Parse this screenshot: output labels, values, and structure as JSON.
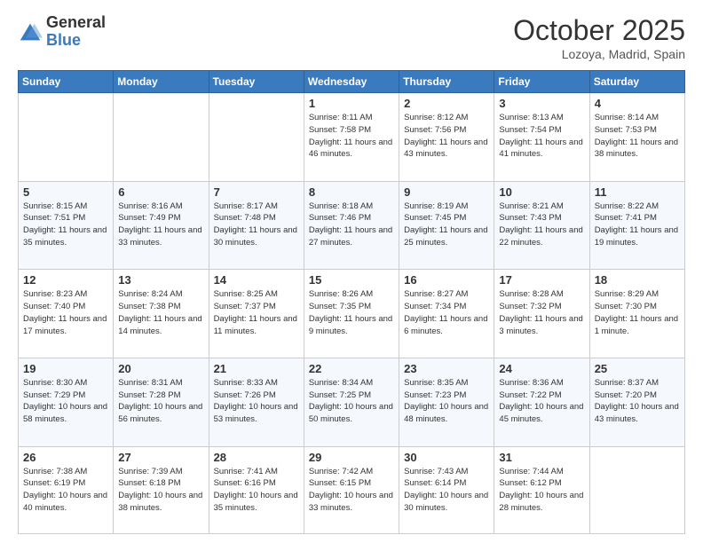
{
  "header": {
    "logo": {
      "general": "General",
      "blue": "Blue"
    },
    "title": "October 2025",
    "location": "Lozoya, Madrid, Spain"
  },
  "days_of_week": [
    "Sunday",
    "Monday",
    "Tuesday",
    "Wednesday",
    "Thursday",
    "Friday",
    "Saturday"
  ],
  "weeks": [
    [
      {
        "day": "",
        "info": ""
      },
      {
        "day": "",
        "info": ""
      },
      {
        "day": "",
        "info": ""
      },
      {
        "day": "1",
        "info": "Sunrise: 8:11 AM\nSunset: 7:58 PM\nDaylight: 11 hours and 46 minutes."
      },
      {
        "day": "2",
        "info": "Sunrise: 8:12 AM\nSunset: 7:56 PM\nDaylight: 11 hours and 43 minutes."
      },
      {
        "day": "3",
        "info": "Sunrise: 8:13 AM\nSunset: 7:54 PM\nDaylight: 11 hours and 41 minutes."
      },
      {
        "day": "4",
        "info": "Sunrise: 8:14 AM\nSunset: 7:53 PM\nDaylight: 11 hours and 38 minutes."
      }
    ],
    [
      {
        "day": "5",
        "info": "Sunrise: 8:15 AM\nSunset: 7:51 PM\nDaylight: 11 hours and 35 minutes."
      },
      {
        "day": "6",
        "info": "Sunrise: 8:16 AM\nSunset: 7:49 PM\nDaylight: 11 hours and 33 minutes."
      },
      {
        "day": "7",
        "info": "Sunrise: 8:17 AM\nSunset: 7:48 PM\nDaylight: 11 hours and 30 minutes."
      },
      {
        "day": "8",
        "info": "Sunrise: 8:18 AM\nSunset: 7:46 PM\nDaylight: 11 hours and 27 minutes."
      },
      {
        "day": "9",
        "info": "Sunrise: 8:19 AM\nSunset: 7:45 PM\nDaylight: 11 hours and 25 minutes."
      },
      {
        "day": "10",
        "info": "Sunrise: 8:21 AM\nSunset: 7:43 PM\nDaylight: 11 hours and 22 minutes."
      },
      {
        "day": "11",
        "info": "Sunrise: 8:22 AM\nSunset: 7:41 PM\nDaylight: 11 hours and 19 minutes."
      }
    ],
    [
      {
        "day": "12",
        "info": "Sunrise: 8:23 AM\nSunset: 7:40 PM\nDaylight: 11 hours and 17 minutes."
      },
      {
        "day": "13",
        "info": "Sunrise: 8:24 AM\nSunset: 7:38 PM\nDaylight: 11 hours and 14 minutes."
      },
      {
        "day": "14",
        "info": "Sunrise: 8:25 AM\nSunset: 7:37 PM\nDaylight: 11 hours and 11 minutes."
      },
      {
        "day": "15",
        "info": "Sunrise: 8:26 AM\nSunset: 7:35 PM\nDaylight: 11 hours and 9 minutes."
      },
      {
        "day": "16",
        "info": "Sunrise: 8:27 AM\nSunset: 7:34 PM\nDaylight: 11 hours and 6 minutes."
      },
      {
        "day": "17",
        "info": "Sunrise: 8:28 AM\nSunset: 7:32 PM\nDaylight: 11 hours and 3 minutes."
      },
      {
        "day": "18",
        "info": "Sunrise: 8:29 AM\nSunset: 7:30 PM\nDaylight: 11 hours and 1 minute."
      }
    ],
    [
      {
        "day": "19",
        "info": "Sunrise: 8:30 AM\nSunset: 7:29 PM\nDaylight: 10 hours and 58 minutes."
      },
      {
        "day": "20",
        "info": "Sunrise: 8:31 AM\nSunset: 7:28 PM\nDaylight: 10 hours and 56 minutes."
      },
      {
        "day": "21",
        "info": "Sunrise: 8:33 AM\nSunset: 7:26 PM\nDaylight: 10 hours and 53 minutes."
      },
      {
        "day": "22",
        "info": "Sunrise: 8:34 AM\nSunset: 7:25 PM\nDaylight: 10 hours and 50 minutes."
      },
      {
        "day": "23",
        "info": "Sunrise: 8:35 AM\nSunset: 7:23 PM\nDaylight: 10 hours and 48 minutes."
      },
      {
        "day": "24",
        "info": "Sunrise: 8:36 AM\nSunset: 7:22 PM\nDaylight: 10 hours and 45 minutes."
      },
      {
        "day": "25",
        "info": "Sunrise: 8:37 AM\nSunset: 7:20 PM\nDaylight: 10 hours and 43 minutes."
      }
    ],
    [
      {
        "day": "26",
        "info": "Sunrise: 7:38 AM\nSunset: 6:19 PM\nDaylight: 10 hours and 40 minutes."
      },
      {
        "day": "27",
        "info": "Sunrise: 7:39 AM\nSunset: 6:18 PM\nDaylight: 10 hours and 38 minutes."
      },
      {
        "day": "28",
        "info": "Sunrise: 7:41 AM\nSunset: 6:16 PM\nDaylight: 10 hours and 35 minutes."
      },
      {
        "day": "29",
        "info": "Sunrise: 7:42 AM\nSunset: 6:15 PM\nDaylight: 10 hours and 33 minutes."
      },
      {
        "day": "30",
        "info": "Sunrise: 7:43 AM\nSunset: 6:14 PM\nDaylight: 10 hours and 30 minutes."
      },
      {
        "day": "31",
        "info": "Sunrise: 7:44 AM\nSunset: 6:12 PM\nDaylight: 10 hours and 28 minutes."
      },
      {
        "day": "",
        "info": ""
      }
    ]
  ]
}
